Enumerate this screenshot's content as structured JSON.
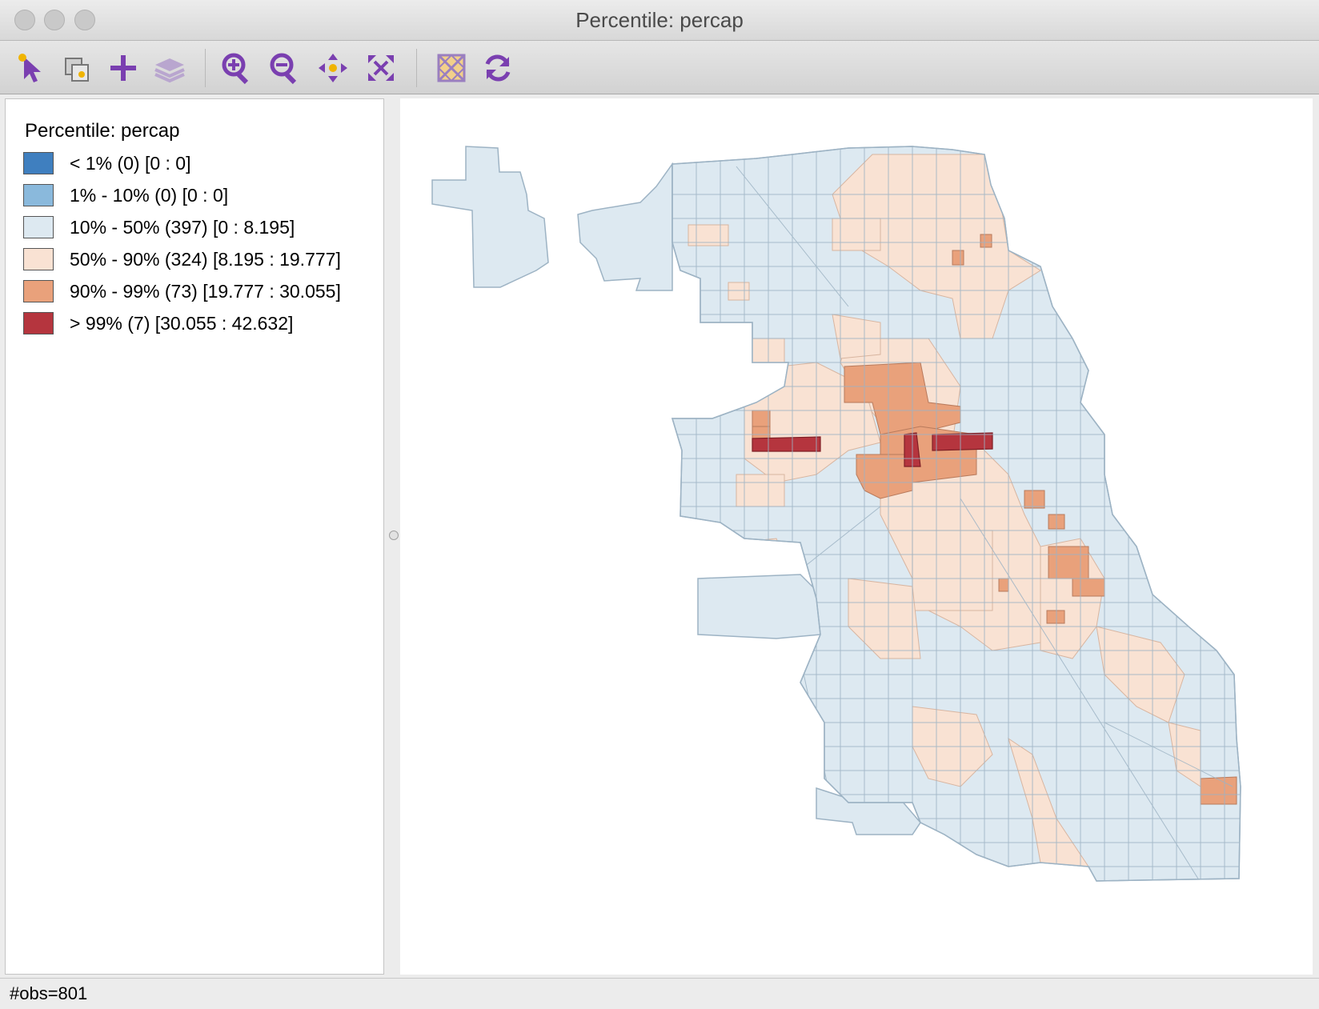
{
  "window": {
    "title": "Percentile: percap"
  },
  "toolbar": {
    "tools": [
      {
        "icon": "select-pointer-icon"
      },
      {
        "icon": "select-mode-icon"
      },
      {
        "icon": "add-layer-icon"
      },
      {
        "icon": "layers-icon"
      },
      {
        "icon": "zoom-in-icon"
      },
      {
        "icon": "zoom-out-icon"
      },
      {
        "icon": "pan-icon"
      },
      {
        "icon": "full-extent-icon"
      },
      {
        "icon": "basemap-icon"
      },
      {
        "icon": "refresh-icon"
      }
    ]
  },
  "legend": {
    "title": "Percentile: percap",
    "items": [
      {
        "label": "< 1% (0)  [0 : 0]",
        "color": "#3f7fbf"
      },
      {
        "label": "1% - 10% (0)  [0 : 0]",
        "color": "#8ab9dc"
      },
      {
        "label": "10% - 50% (397)  [0 : 8.195]",
        "color": "#dde9f1"
      },
      {
        "label": "50% - 90% (324)  [8.195 : 19.777]",
        "color": "#f9e2d3"
      },
      {
        "label": "90% - 99% (73)  [19.777 : 30.055]",
        "color": "#e9a17b"
      },
      {
        "label": "> 99% (7)  [30.055 : 42.632]",
        "color": "#b5353e"
      }
    ]
  },
  "status": {
    "text": "#obs=801"
  }
}
